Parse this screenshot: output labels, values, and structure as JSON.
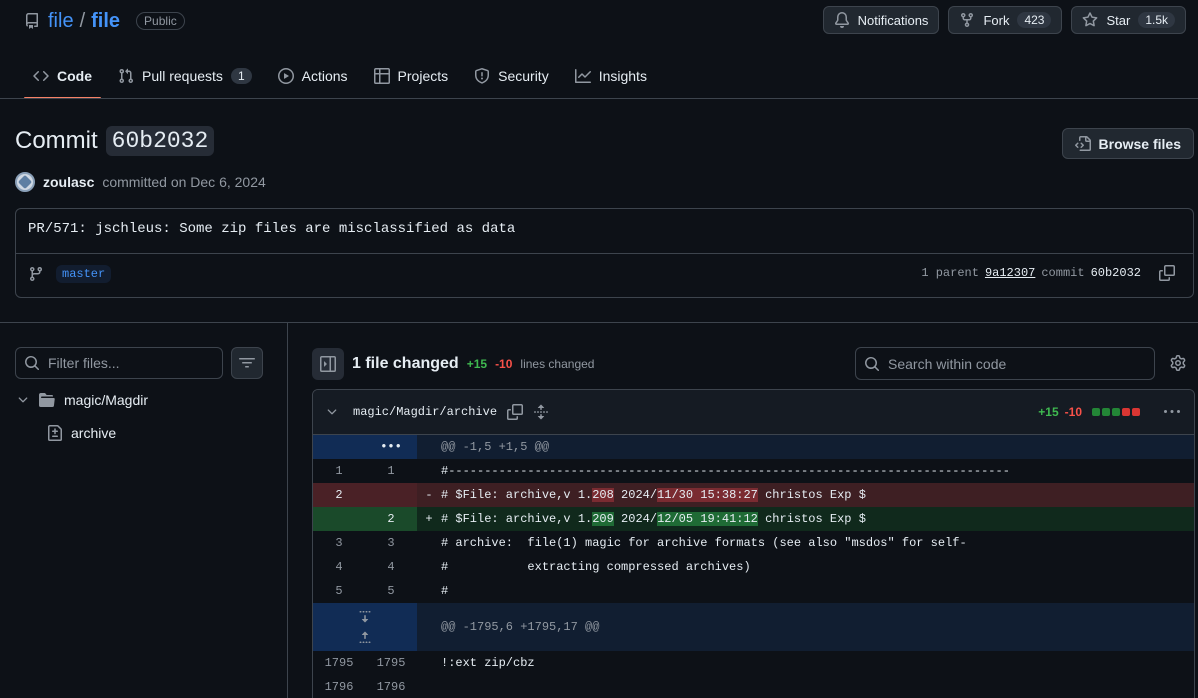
{
  "repo": {
    "owner": "file",
    "separator": "/",
    "name": "file",
    "visibility": "Public"
  },
  "header_actions": {
    "notifications": "Notifications",
    "fork_label": "Fork",
    "fork_count": "423",
    "star_label": "Star",
    "star_count": "1.5k"
  },
  "tabs": [
    {
      "label": "Code",
      "icon": "code-icon",
      "active": true
    },
    {
      "label": "Pull requests",
      "icon": "git-pull-request-icon",
      "count": "1"
    },
    {
      "label": "Actions",
      "icon": "play-icon"
    },
    {
      "label": "Projects",
      "icon": "table-icon"
    },
    {
      "label": "Security",
      "icon": "shield-icon"
    },
    {
      "label": "Insights",
      "icon": "graph-icon"
    }
  ],
  "commit": {
    "title_prefix": "Commit",
    "sha": "60b2032",
    "browse_files": "Browse files",
    "author": "zoulasc",
    "committed_text": "committed on Dec 6, 2024",
    "message": "PR/571: jschleus: Some zip files are misclassified as data",
    "branch": "master",
    "parent_label": "1 parent",
    "parent_sha": "9a12307",
    "commit_label": "commit",
    "commit_sha": "60b2032"
  },
  "file_tree": {
    "filter_placeholder": "Filter files...",
    "directory": "magic/Magdir",
    "file": "archive"
  },
  "diff_toolbar": {
    "files_changed": "1 file changed",
    "additions": "+15",
    "deletions": "-10",
    "lines_changed": "lines changed",
    "search_placeholder": "Search within code"
  },
  "diff_file": {
    "path": "magic/Magdir/archive",
    "additions": "+15",
    "deletions": "-10",
    "hunk1": "@@ -1,5 +1,5 @@",
    "hunk2": "@@ -1795,6 +1795,17 @@",
    "lines": [
      {
        "type": "ctx",
        "old": "1",
        "new": "1",
        "sign": "",
        "code": "#------------------------------------------------------------------------------"
      },
      {
        "type": "del",
        "old": "2",
        "new": "",
        "sign": "-",
        "pre": "# $File: archive,v 1.",
        "hl1": "208",
        "mid": " 2024/",
        "hl2": "11/30 15:38:27",
        "post": " christos Exp $"
      },
      {
        "type": "add",
        "old": "",
        "new": "2",
        "sign": "+",
        "pre": "# $File: archive,v 1.",
        "hl1": "209",
        "mid": " 2024/",
        "hl2": "12/05 19:41:12",
        "post": " christos Exp $"
      },
      {
        "type": "ctx",
        "old": "3",
        "new": "3",
        "sign": "",
        "code": "# archive:  file(1) magic for archive formats (see also \"msdos\" for self-"
      },
      {
        "type": "ctx",
        "old": "4",
        "new": "4",
        "sign": "",
        "code": "#           extracting compressed archives)"
      },
      {
        "type": "ctx",
        "old": "5",
        "new": "5",
        "sign": "",
        "code": "#"
      }
    ],
    "lines2": [
      {
        "old": "1795",
        "new": "1795",
        "code": "!:ext zip/cbz"
      },
      {
        "old": "1796",
        "new": "1796",
        "code": ""
      }
    ]
  }
}
